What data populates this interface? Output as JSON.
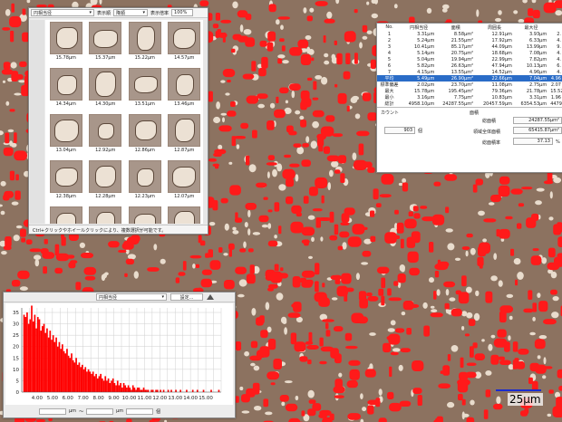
{
  "thumbnail_panel": {
    "sort_field": "円相当径",
    "order_label": "表示順",
    "order_value": "降順",
    "zoom_label": "表示倍率",
    "zoom_value": "100%",
    "footer_text": "Ctrl+クリックやホイールクリックにより、複数選択が可能です。",
    "items": [
      {
        "label": "15.78μm"
      },
      {
        "label": "15.37μm"
      },
      {
        "label": "15.22μm"
      },
      {
        "label": "14.57μm"
      },
      {
        "label": "14.34μm"
      },
      {
        "label": "14.30μm"
      },
      {
        "label": "13.51μm"
      },
      {
        "label": "13.46μm"
      },
      {
        "label": "13.04μm"
      },
      {
        "label": "12.92μm"
      },
      {
        "label": "12.86μm"
      },
      {
        "label": "12.87μm"
      },
      {
        "label": "12.38μm"
      },
      {
        "label": "12.28μm"
      },
      {
        "label": "12.23μm"
      },
      {
        "label": "12.07μm"
      },
      {
        "label": ""
      },
      {
        "label": ""
      },
      {
        "label": ""
      },
      {
        "label": ""
      }
    ]
  },
  "stats_panel": {
    "headers": [
      "No.",
      "円相当径",
      "面積",
      "周囲長",
      "最大径",
      ""
    ],
    "rows": [
      [
        "1",
        "3.31μm",
        "8.58μm²",
        "12.91μm",
        "3.93μm",
        "2."
      ],
      [
        "2",
        "5.24μm",
        "21.55μm²",
        "17.92μm",
        "6.33μm",
        "4."
      ],
      [
        "3",
        "10.41μm",
        "85.17μm²",
        "44.09μm",
        "13.99μm",
        "9."
      ],
      [
        "4",
        "5.14μm",
        "20.75μm²",
        "18.68μm",
        "7.08μm",
        "4."
      ],
      [
        "5",
        "5.04μm",
        "19.94μm²",
        "22.99μm",
        "7.82μm",
        "4."
      ],
      [
        "6",
        "5.82μm",
        "26.63μm²",
        "47.94μm",
        "10.13μm",
        "6."
      ],
      [
        "7",
        "4.15μm",
        "13.55μm²",
        "14.52μm",
        "4.96μm",
        "4."
      ]
    ],
    "summary": [
      [
        "平均",
        "5.49μm",
        "26.90μm²",
        "22.66μm",
        "7.04μm",
        "4.96"
      ],
      [
        "標準偏差",
        "2.02μm",
        "23.70μm²",
        "11.08μm",
        "2.75μm",
        "2.07"
      ],
      [
        "最大",
        "15.78μm",
        "195.45μm²",
        "79.36μm",
        "21.78μm",
        "15.52"
      ],
      [
        "最小",
        "3.16μm",
        "7.75μm²",
        "10.83μm",
        "3.31μm",
        "1.96"
      ],
      [
        "総計",
        "4958.10μm",
        "24287.55μm²",
        "20457.59μm",
        "6354.53μm",
        "4479.95"
      ]
    ],
    "count_label": "カウント",
    "area_label": "面積",
    "count_value": "903",
    "count_unit": "個",
    "total_area_label": "総面積",
    "total_area_value": "24287.55μm²",
    "region_area_label": "領域全体面積",
    "region_area_value": "65415.87μm²",
    "area_ratio_label": "総面積率",
    "area_ratio_value": "37.13",
    "area_ratio_unit": "%"
  },
  "histogram_panel": {
    "field_select": "円相当径",
    "settings_button": "設定...",
    "range_unit_1": "μm",
    "range_tilde": "〜",
    "range_unit_2": "μm",
    "count_unit": "個"
  },
  "scale_bar": {
    "label": "25μm"
  },
  "chart_data": {
    "type": "bar",
    "title": "",
    "xlabel": "",
    "ylabel": "",
    "x_tick_labels": [
      "4.00",
      "5.00",
      "6.00",
      "7.00",
      "8.00",
      "9.00",
      "10.00",
      "11.00",
      "12.00",
      "13.00",
      "14.00",
      "15.00"
    ],
    "y_tick_labels": [
      "0",
      "5",
      "10",
      "15",
      "20",
      "25",
      "30",
      "35"
    ],
    "ylim": [
      0,
      37
    ],
    "xlim": [
      3.0,
      16.0
    ],
    "bin_width": 0.1,
    "bin_start": 3.1,
    "values": [
      34,
      33,
      35,
      30,
      32,
      38,
      31,
      34,
      28,
      33,
      32,
      27,
      29,
      30,
      26,
      28,
      24,
      27,
      23,
      25,
      22,
      24,
      20,
      22,
      19,
      21,
      18,
      17,
      19,
      16,
      15,
      17,
      14,
      13,
      15,
      12,
      13,
      11,
      12,
      10,
      11,
      9,
      10,
      9,
      8,
      9,
      7,
      8,
      6,
      7,
      8,
      6,
      5,
      7,
      5,
      6,
      4,
      5,
      6,
      4,
      3,
      5,
      3,
      4,
      2,
      4,
      3,
      2,
      3,
      2,
      1,
      3,
      2,
      1,
      2,
      2,
      1,
      1,
      2,
      1,
      1,
      1,
      0,
      1,
      1,
      0,
      1,
      1,
      0,
      1,
      0,
      1,
      0,
      0,
      1,
      0,
      1,
      0,
      0,
      1,
      0,
      0,
      1,
      0,
      0,
      0,
      1,
      0,
      0,
      0,
      1,
      0,
      0,
      1,
      0,
      0,
      0,
      1,
      0,
      0,
      0,
      0,
      1,
      0,
      0,
      0,
      0,
      1
    ],
    "grid": true,
    "bar_color": "#ff0000"
  },
  "colors": {
    "background": "#8c7260",
    "grain_fill": "#ff1a1a",
    "accent_select": "#2a6cc7"
  }
}
